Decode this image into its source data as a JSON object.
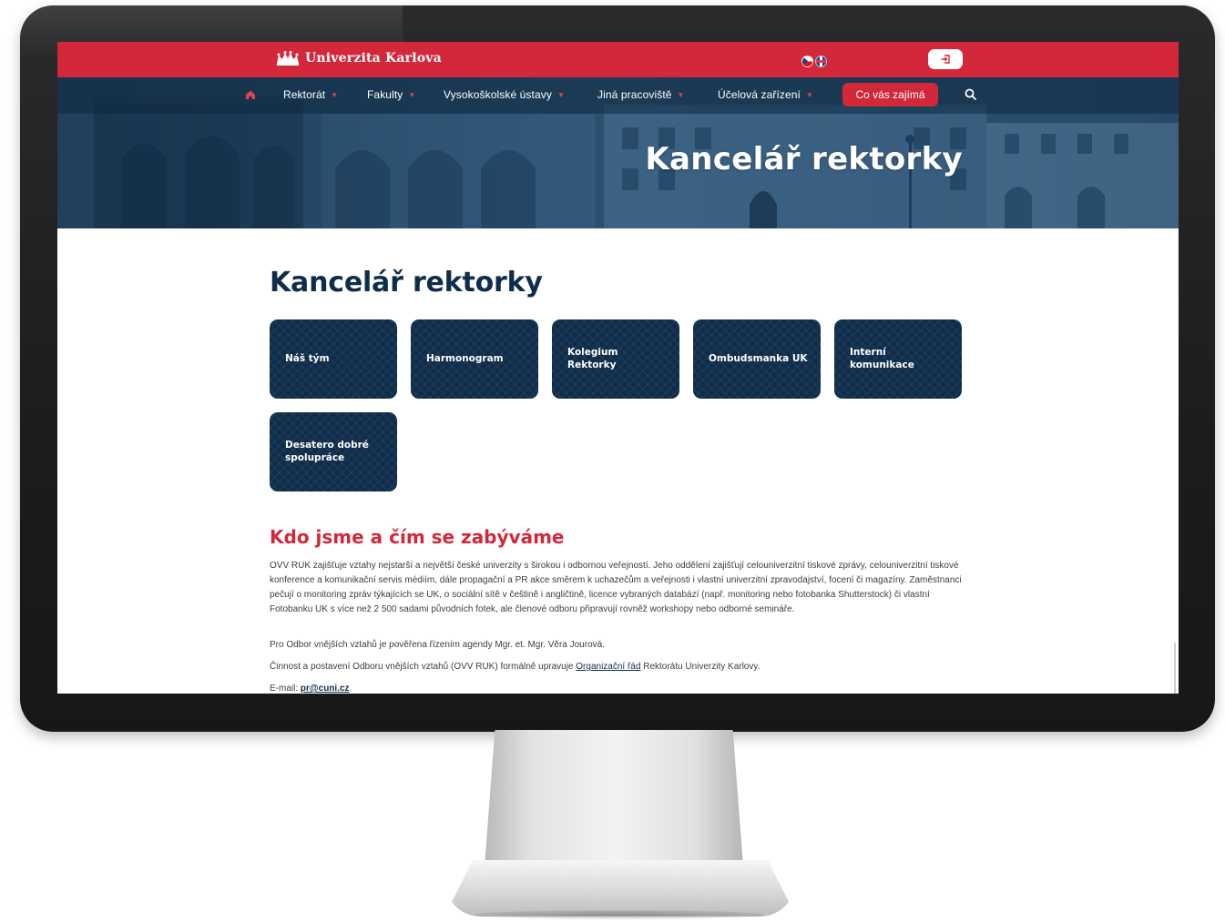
{
  "brand": {
    "name": "Univerzita Karlova"
  },
  "colors": {
    "accent": "#d3283a",
    "primary_dark": "#0f2d4b",
    "body_text": "#3a3f46"
  },
  "header": {
    "languages": [
      {
        "icon": "flag-cz-icon"
      },
      {
        "icon": "flag-en-icon"
      }
    ],
    "login_icon": "login-icon"
  },
  "nav": {
    "home_icon": "home-icon",
    "items": [
      {
        "label": "Rektorát"
      },
      {
        "label": "Fakulty"
      },
      {
        "label": "Vysokoškolské ústavy"
      },
      {
        "label": "Jiná pracoviště"
      },
      {
        "label": "Účelová zařízení"
      }
    ],
    "cta_label": "Co vás zajímá",
    "search_icon": "search-icon"
  },
  "hero": {
    "title": "Kancelář rektorky"
  },
  "main": {
    "title": "Kancelář rektorky",
    "tiles": [
      {
        "label": "Náš tým"
      },
      {
        "label": "Harmonogram"
      },
      {
        "label": "Kolegium Rektorky"
      },
      {
        "label": "Ombudsmanka UK"
      },
      {
        "label": "Interní komunikace"
      },
      {
        "label": "Desatero dobré spolupráce"
      }
    ],
    "section": {
      "heading": "Kdo jsme a čím se zabýváme",
      "paragraph_1": "OVV RUK zajišťuje vztahy nejstarší a největší české univerzity s širokou i odbornou veřejností. Jeho oddělení zajišťují celouniverzitní tiskové zprávy, celouniverzitní tiskové konference a komunikační servis médiím, dále propagační a PR akce směrem k uchazečům a veřejnosti i vlastní univerzitní zpravodajství, focení či magazíny. Zaměstnanci pečují o monitoring zpráv týkajících se UK, o sociální sítě v češtině i angličtině, licence vybraných databází (např. monitoring nebo fotobanka Shutterstock) či vlastní Fotobanku UK s více než 2 500 sadami původních fotek, ale členové odboru připravují rovněž workshopy nebo odborné semináře.",
      "paragraph_2": "Pro Odbor vnějších vztahů je pověřena řízením agendy Mgr. et. Mgr. Věra Jourová.",
      "paragraph_3_before": "Činnost a postavení Odboru vnějších vztahů (OVV RUK) formálně upravuje ",
      "paragraph_3_link": "Organizační řád",
      "paragraph_3_after": " Rektorátu Univerzity Karlovy.",
      "email_label": "E-mail: ",
      "email_value": "pr@cuni.cz"
    }
  }
}
